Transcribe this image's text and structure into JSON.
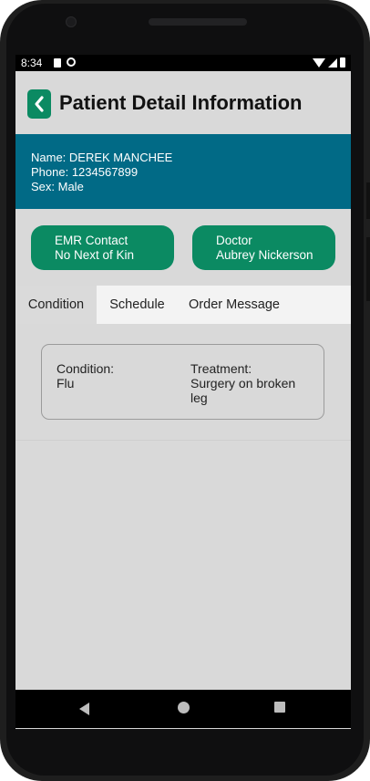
{
  "status_bar": {
    "time": "8:34"
  },
  "header": {
    "title": "Patient Detail Information"
  },
  "patient": {
    "name_line": "Name: DEREK MANCHEE",
    "phone_line": "Phone: 1234567899",
    "sex_line": "Sex: Male"
  },
  "buttons": {
    "emr": {
      "line1": "EMR Contact",
      "line2": "No Next of Kin"
    },
    "doctor": {
      "line1": "Doctor",
      "line2": "Aubrey Nickerson"
    }
  },
  "tabs": [
    {
      "label": "Condition",
      "active": true
    },
    {
      "label": "Schedule",
      "active": false
    },
    {
      "label": "Order Message",
      "active": false
    }
  ],
  "condition_card": {
    "condition_label": "Condition:",
    "condition_value": "Flu",
    "treatment_label": "Treatment:",
    "treatment_value_line1": "Surgery on broken",
    "treatment_value_line2": "leg"
  },
  "colors": {
    "accent_green": "#0b8a62",
    "patient_panel": "#016a86",
    "screen_bg": "#d9d9d9"
  },
  "icons": {
    "back": "chevron-left-icon",
    "nav_back": "triangle-back-icon",
    "nav_home": "circle-home-icon",
    "nav_recent": "square-recents-icon"
  }
}
